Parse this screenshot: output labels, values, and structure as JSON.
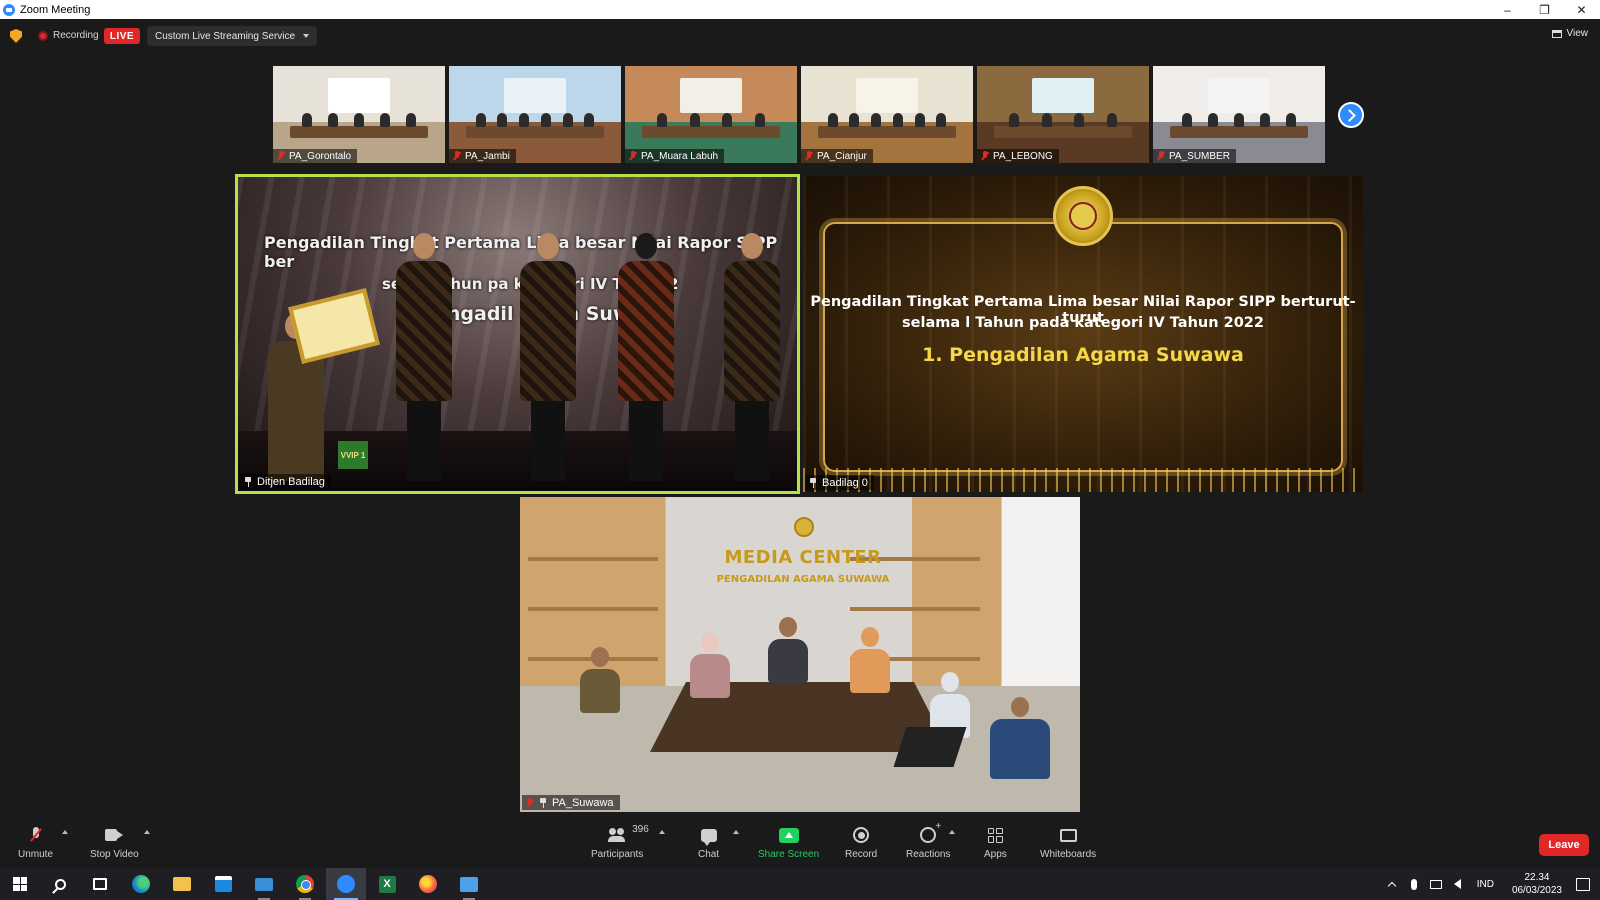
{
  "window": {
    "title": "Zoom Meeting",
    "controls": [
      "–",
      "❐",
      "✕"
    ]
  },
  "topbar": {
    "recording_label": "Recording",
    "live_label": "LIVE",
    "stream_service": "Custom Live Streaming Service",
    "view_label": "View"
  },
  "gallery_strip": [
    {
      "name": "PA_Gorontalo",
      "muted": true,
      "wall": "#e7e2d8",
      "floor": "#b9a58a",
      "panel": "#ffffff"
    },
    {
      "name": "PA_Jambi",
      "muted": true,
      "wall": "#bcd6ea",
      "floor": "#8a5a3a",
      "panel": "#e9f2f7"
    },
    {
      "name": "PA_Muara Labuh",
      "muted": true,
      "wall": "#c48a5a",
      "floor": "#3a7a5a",
      "panel": "#f2efe6"
    },
    {
      "name": "PA_Cianjur",
      "muted": true,
      "wall": "#e8e2d2",
      "floor": "#a4743e",
      "panel": "#f7f3e8"
    },
    {
      "name": "PA_LEBONG",
      "muted": true,
      "wall": "#8a6a3e",
      "floor": "#5a3a22",
      "panel": "#dff1f4"
    },
    {
      "name": "PA_SUMBER",
      "muted": true,
      "wall": "#efecea",
      "floor": "#8a8a92",
      "panel": "#f4f4f4"
    }
  ],
  "tiles": {
    "left": {
      "name": "Ditjen Badilag",
      "stage_line1": "Pengadilan Tingkat Pertama Lima besar Nilai Rapor SIPP ber",
      "stage_line2": "sela   l Tahun pa   kategori IV Tahun 2",
      "stage_line3": "engadil   gama  Suwawa",
      "sign": "VVIP 1",
      "highlight_color": "#b8e04a"
    },
    "right": {
      "name": "Badilag 0",
      "line1": "Pengadilan Tingkat Pertama Lima besar Nilai Rapor SIPP berturut-turut",
      "line2": "selama l Tahun pada kategori IV Tahun 2022",
      "line3": "1. Pengadilan Agama Suwawa"
    },
    "bottom": {
      "name": "PA_Suwawa",
      "muted": true,
      "sign_line1": "MEDIA CENTER",
      "sign_line2": "PENGADILAN AGAMA SUWAWA"
    }
  },
  "toolbar": {
    "unmute": "Unmute",
    "stop_video": "Stop Video",
    "participants": "Participants",
    "participant_count": "396",
    "chat": "Chat",
    "share_screen": "Share Screen",
    "record": "Record",
    "reactions": "Reactions",
    "apps": "Apps",
    "whiteboards": "Whiteboards",
    "leave": "Leave"
  },
  "taskbar": {
    "language": "IND",
    "time": "22.34",
    "date": "06/03/2023"
  },
  "colors": {
    "zoom_blue": "#2d8cff",
    "live_red": "#e02828",
    "share_green": "#23d160"
  }
}
